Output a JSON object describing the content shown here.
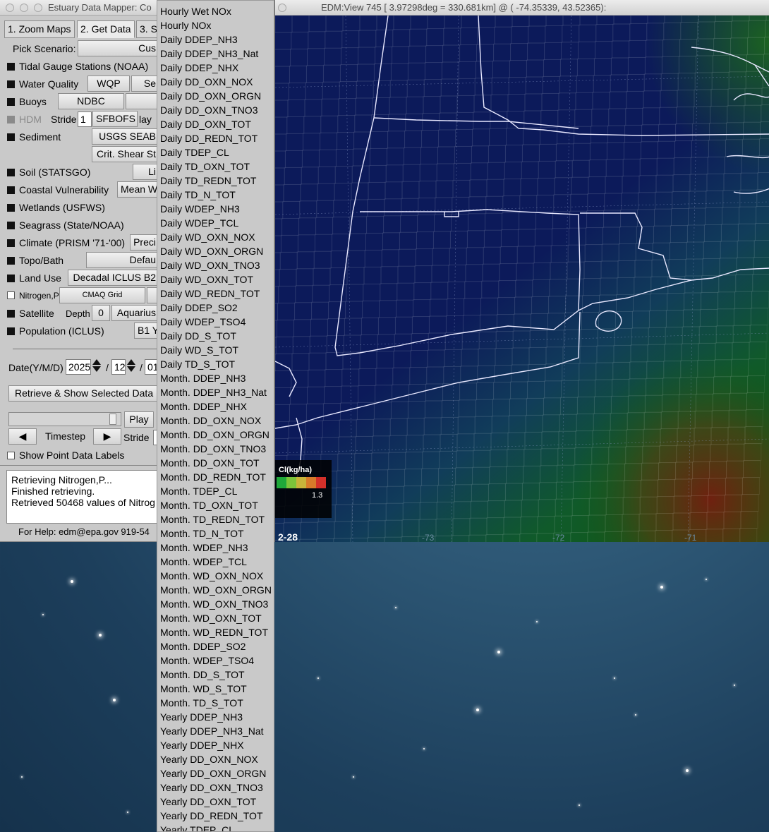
{
  "left_window": {
    "title": "Estuary Data Mapper: Co",
    "tabs": [
      "1. Zoom Maps",
      "2. Get Data",
      "3. S"
    ],
    "pick_scenario_label": "Pick Scenario:",
    "pick_scenario_value": "Cus",
    "layers": {
      "tidal": "Tidal Gauge Stations (NOAA)",
      "water_quality": "Water Quality",
      "wqp_button": "WQP",
      "water_quality_extra": "Se",
      "buoys": "Buoys",
      "ndbc_button": "NDBC",
      "hdm": "HDM",
      "stride_label": "Stride",
      "stride_value": "1",
      "sfbofs_button": "SFBOFS",
      "lay_label": "lay",
      "sediment": "Sediment",
      "usgs_button": "USGS SEAB",
      "crit_button": "Crit. Shear St",
      "soil": "Soil (STATSGO)",
      "soil_button": "Li",
      "coastal": "Coastal Vulnerability",
      "coastal_button": "Mean W",
      "wetlands": "Wetlands (USFWS)",
      "seagrass": "Seagrass (State/NOAA)",
      "climate": "Climate (PRISM '71-'00)",
      "climate_button": "Preci",
      "topo": "Topo/Bath",
      "topo_button": "Defau",
      "landuse": "Land Use",
      "landuse_button": "Decadal ICLUS B2",
      "nitrogen": "Nitrogen,P",
      "cmaq_button": "CMAQ Grid",
      "satellite": "Satellite",
      "depth_label": "Depth",
      "depth_value": "0",
      "aquarius_button": "Aquarius",
      "population": "Population (ICLUS)",
      "population_button": "B1 Y"
    },
    "date_label": "Date(Y/M/D)",
    "date_year": "2025",
    "date_month": "12",
    "date_day": "01",
    "retrieve_button": "Retrieve & Show Selected Data",
    "play_button": "Play",
    "timestep_label": "Timestep",
    "stride_label2": "Stride",
    "show_labels": "Show Point Data Labels",
    "log_lines": [
      "Retrieving Nitrogen,P...",
      "Finished retrieving.",
      "Retrieved 50468 values of Nitrog"
    ],
    "help_text": "For Help: edm@epa.gov 919-54"
  },
  "map_window": {
    "title": "EDM:View 745 [ 3.97298deg =  330.681km] @ ( -74.35339, 43.52365):",
    "legend_title": "Cl(kg/ha)",
    "legend_max": "1.3",
    "date_stamp": "2-28",
    "lon_labels": [
      "-73",
      "-72",
      "-71"
    ],
    "colors": {
      "navy": "#0c1a5a",
      "green": "#0e5a12",
      "red": "#7a1a0e"
    }
  },
  "menu": {
    "items": [
      "Hourly Wet NOx",
      "Hourly NOx",
      "Daily DDEP_NH3",
      "Daily DDEP_NH3_Nat",
      "Daily DDEP_NHX",
      "Daily DD_OXN_NOX",
      "Daily DD_OXN_ORGN",
      "Daily DD_OXN_TNO3",
      "Daily DD_OXN_TOT",
      "Daily DD_REDN_TOT",
      "Daily TDEP_CL",
      "Daily TD_OXN_TOT",
      "Daily TD_REDN_TOT",
      "Daily TD_N_TOT",
      "Daily WDEP_NH3",
      "Daily WDEP_TCL",
      "Daily WD_OXN_NOX",
      "Daily WD_OXN_ORGN",
      "Daily WD_OXN_TNO3",
      "Daily WD_OXN_TOT",
      "Daily WD_REDN_TOT",
      "Daily DDEP_SO2",
      "Daily WDEP_TSO4",
      "Daily DD_S_TOT",
      "Daily WD_S_TOT",
      "Daily TD_S_TOT",
      "Month. DDEP_NH3",
      "Month. DDEP_NH3_Nat",
      "Month. DDEP_NHX",
      "Month. DD_OXN_NOX",
      "Month. DD_OXN_ORGN",
      "Month. DD_OXN_TNO3",
      "Month. DD_OXN_TOT",
      "Month. DD_REDN_TOT",
      "Month. TDEP_CL",
      "Month. TD_OXN_TOT",
      "Month. TD_REDN_TOT",
      "Month. TD_N_TOT",
      "Month. WDEP_NH3",
      "Month. WDEP_TCL",
      "Month. WD_OXN_NOX",
      "Month. WD_OXN_ORGN",
      "Month. WD_OXN_TNO3",
      "Month. WD_OXN_TOT",
      "Month. WD_REDN_TOT",
      "Month. DDEP_SO2",
      "Month. WDEP_TSO4",
      "Month. DD_S_TOT",
      "Month. WD_S_TOT",
      "Month. TD_S_TOT",
      "Yearly DDEP_NH3",
      "Yearly DDEP_NH3_Nat",
      "Yearly DDEP_NHX",
      "Yearly DD_OXN_NOX",
      "Yearly DD_OXN_ORGN",
      "Yearly DD_OXN_TNO3",
      "Yearly DD_OXN_TOT",
      "Yearly DD_REDN_TOT",
      "Yearly TDEP_CL"
    ]
  }
}
